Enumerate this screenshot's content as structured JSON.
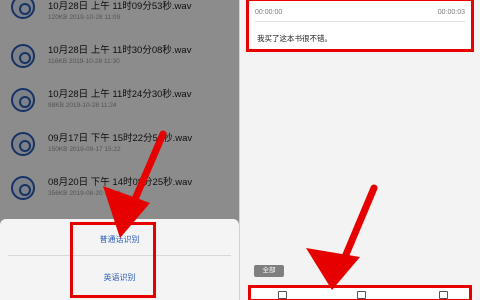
{
  "left_screen": {
    "files": [
      {
        "name": "10月28日 上午 11时09分53秒.wav",
        "meta": "120KB  2019-10-28 11:09"
      },
      {
        "name": "10月28日 上午 11时30分08秒.wav",
        "meta": "116KB  2019-10-28 11:30"
      },
      {
        "name": "10月28日 上午 11时24分30秒.wav",
        "meta": "98KB  2019-10-28 11:24"
      },
      {
        "name": "09月17日 下午 15时22分54秒.wav",
        "meta": "150KB  2019-09-17 15:22"
      },
      {
        "name": "08月20日 下午 14时08分25秒.wav",
        "meta": "356KB  2019-08-20 14:08"
      }
    ],
    "sheet": {
      "option_mandarin": "普通话识别",
      "option_english": "英语识别"
    }
  },
  "right_screen": {
    "time_start": "00:00:00",
    "time_end": "00:00:03",
    "transcript": "我买了这本书很不错。",
    "select_all": "全部"
  },
  "colors": {
    "highlight": "#e60000",
    "accent": "#2a5bb8"
  },
  "icons": [
    "audio-file-icon",
    "copy-icon",
    "edit-icon",
    "share-icon",
    "arrow-icon"
  ]
}
